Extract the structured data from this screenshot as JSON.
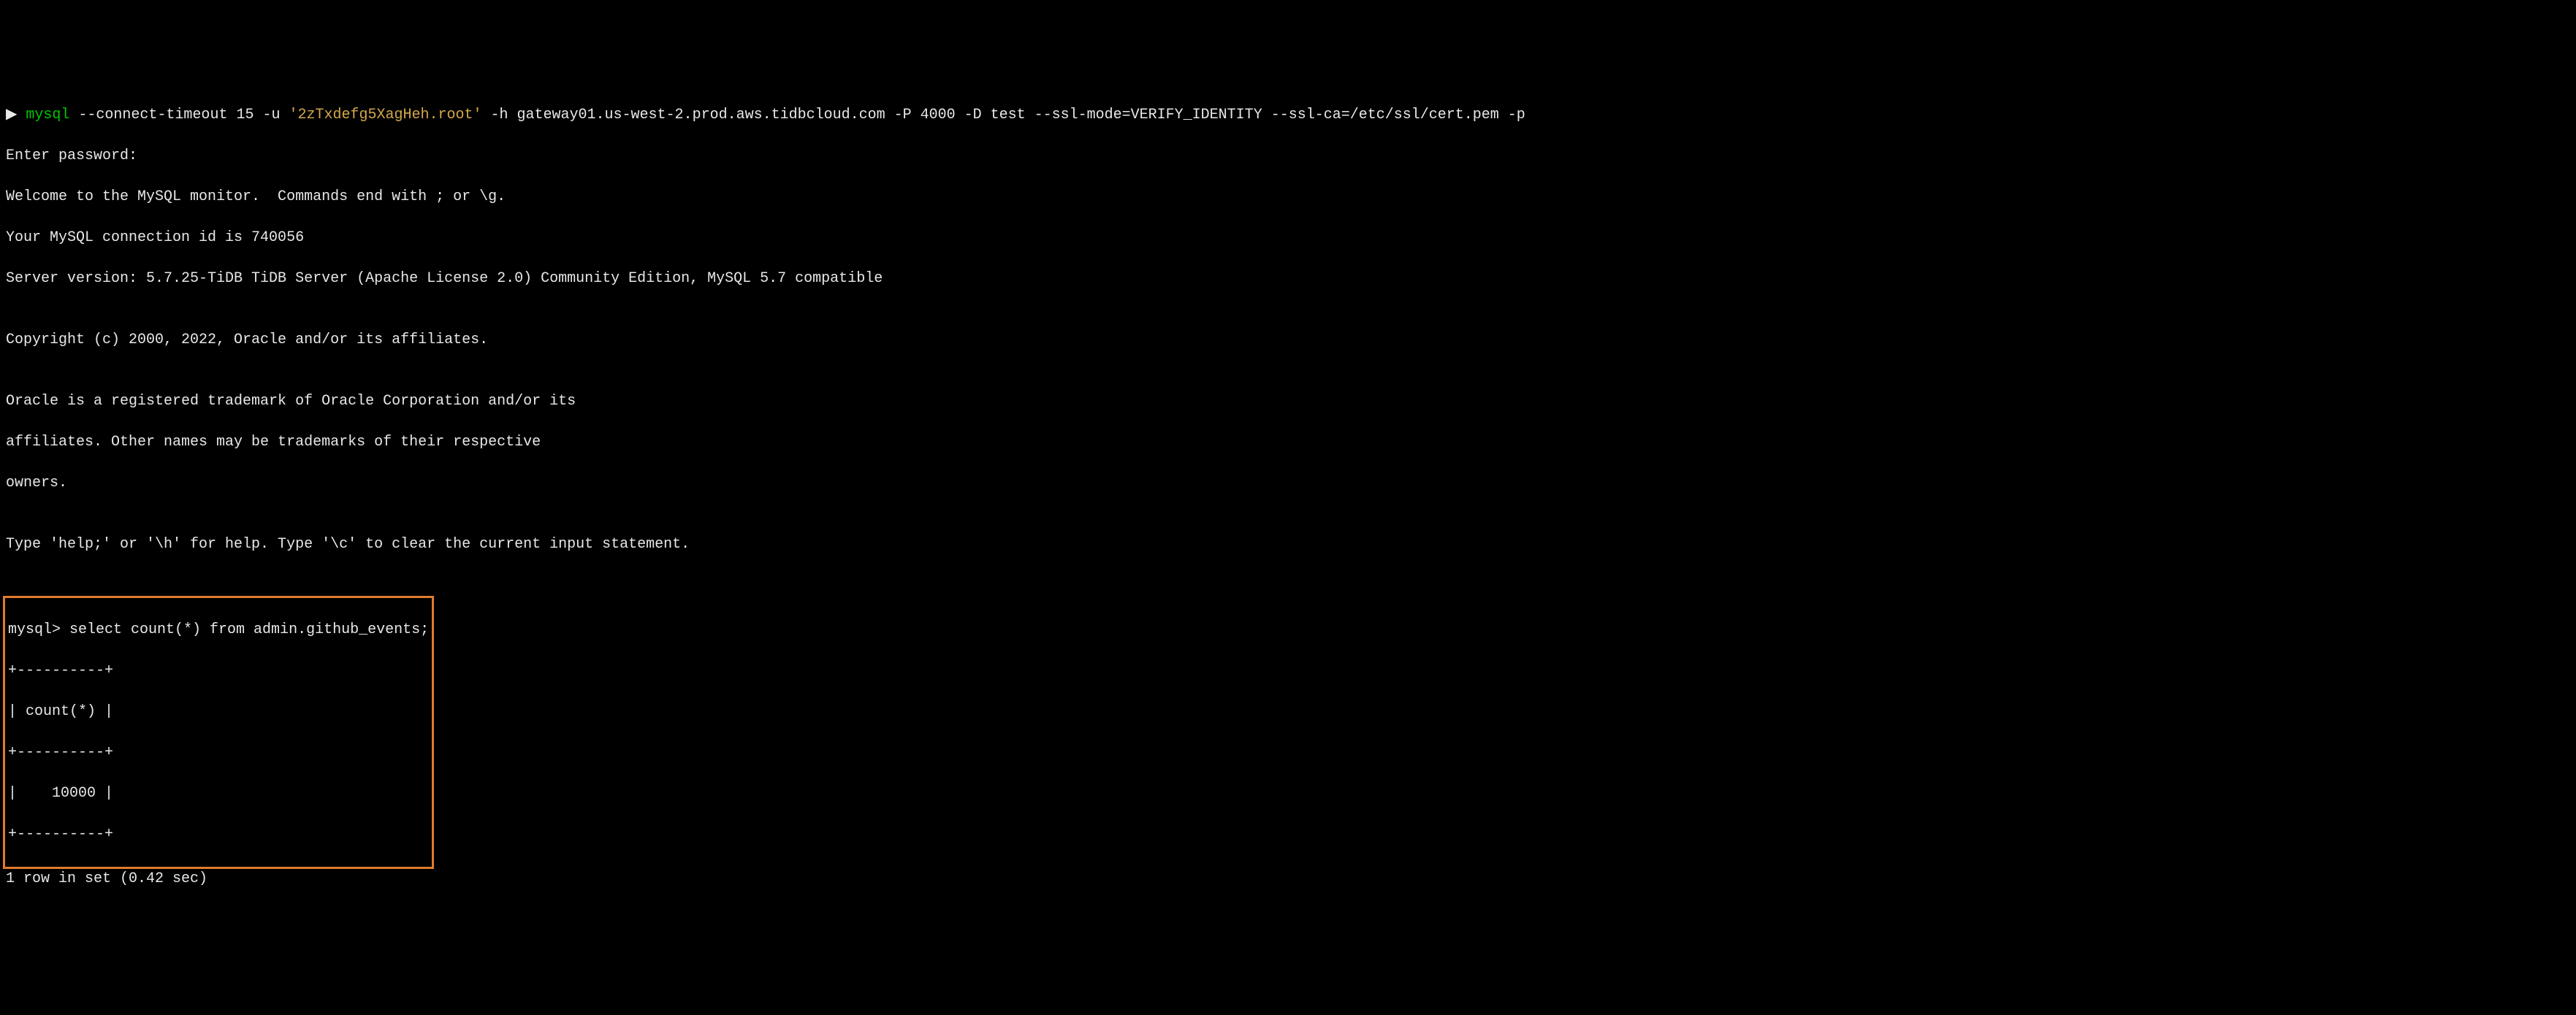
{
  "command_line": {
    "prompt_arrow": "▶ ",
    "mysql_cmd": "mysql",
    "args_before_user": " --connect-timeout 15 -u ",
    "user_quoted": "'2zTxdefg5XagHeh.root'",
    "args_after_user": " -h gateway01.us-west-2.prod.aws.tidbcloud.com -P 4000 -D test --ssl-mode=VERIFY_IDENTITY --ssl-ca=/etc/ssl/cert.pem -p"
  },
  "output_lines": {
    "enter_password": "Enter password:",
    "welcome": "Welcome to the MySQL monitor.  Commands end with ; or \\g.",
    "connection_id": "Your MySQL connection id is 740056",
    "server_version": "Server version: 5.7.25-TiDB TiDB Server (Apache License 2.0) Community Edition, MySQL 5.7 compatible",
    "blank1": "",
    "copyright": "Copyright (c) 2000, 2022, Oracle and/or its affiliates.",
    "blank2": "",
    "trademark1": "Oracle is a registered trademark of Oracle Corporation and/or its",
    "trademark2": "affiliates. Other names may be trademarks of their respective",
    "trademark3": "owners.",
    "blank3": "",
    "help_line": "Type 'help;' or '\\h' for help. Type '\\c' to clear the current input statement.",
    "blank4": ""
  },
  "query_block": {
    "query": "mysql> select count(*) from admin.github_events;",
    "sep1": "+----------+",
    "header": "| count(*) |",
    "sep2": "+----------+",
    "value": "|    10000 |",
    "sep3": "+----------+"
  },
  "footer": {
    "rows_line": "1 row in set (0.42 sec)"
  }
}
